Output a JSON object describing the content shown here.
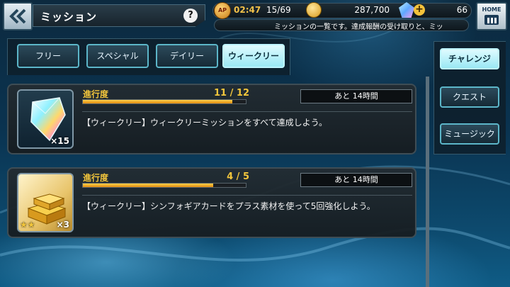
{
  "header": {
    "title": "ミッション",
    "help": "?",
    "ap_icon": "AP",
    "timer": "02:47",
    "ap": "15/69",
    "coins": "287,700",
    "gems": "66",
    "home_label": "HOME",
    "ticker": "ミッションの一覧です。達成報酬の受け取りと、ミッ"
  },
  "tabs": [
    {
      "label": "フリー",
      "active": false
    },
    {
      "label": "スペシャル",
      "active": false
    },
    {
      "label": "デイリー",
      "active": false
    },
    {
      "label": "ウィークリー",
      "active": true
    }
  ],
  "side_tabs": [
    {
      "label": "チャレンジ",
      "active": true
    },
    {
      "label": "クエスト",
      "active": false
    },
    {
      "label": "ミュージック",
      "active": false
    }
  ],
  "missions": [
    {
      "icon": "rainbow-crystal-icon",
      "quantity": "×15",
      "progress_label": "進行度",
      "progress_text": "11 / 12",
      "progress_fraction": 0.917,
      "time_left": "あと 14時間",
      "description": "【ウィークリー】ウィークリーミッションをすべて達成しよう。"
    },
    {
      "icon": "gold-bars-icon",
      "stars": "★★",
      "quantity": "×3",
      "progress_label": "進行度",
      "progress_text": "4 / 5",
      "progress_fraction": 0.8,
      "time_left": "あと 14時間",
      "description": "【ウィークリー】シンフォギアカードをプラス素材を使って5回強化しよう。"
    }
  ],
  "colors": {
    "accent": "#9ae8f4",
    "progress": "#f3c63c",
    "frame": "#5cb6c9"
  }
}
